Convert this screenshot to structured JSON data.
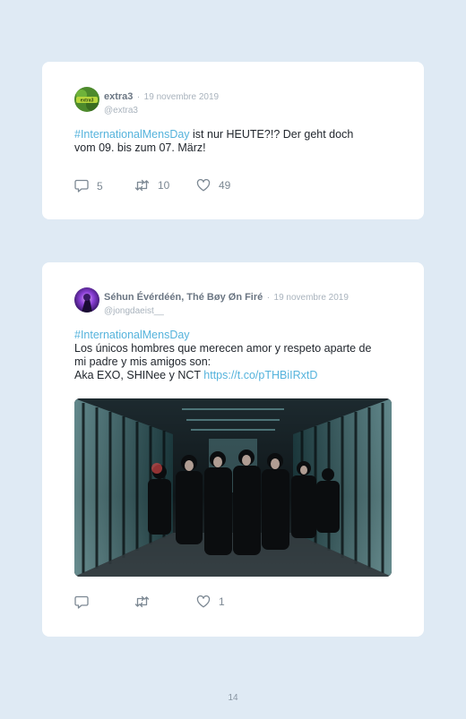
{
  "tweets": [
    {
      "name": "extra3",
      "separator": "·",
      "date": "19 novembre 2019",
      "handle": "@extra3",
      "avatar_text": "extra3",
      "hashtag": "#InternationalMensDay",
      "text_after_tag": " ist nur HEUTE?!? Der geht doch",
      "text_line2": "vom 09. bis zum 07. März!",
      "reply_count": "5",
      "retweet_count": "10",
      "like_count": "49"
    },
    {
      "name": "Séhun Évérdéén, Thé Bøy Øn Firé",
      "separator": "·",
      "date": "19 novembre 2019",
      "handle": "@jongdaeist__",
      "hashtag": "#InternationalMensDay",
      "line2": "Los únicos hombres que merecen amor y respeto aparte de",
      "line3": "mi padre y mis amigos son:",
      "line4_text": "Aka EXO, SHINee y NCT ",
      "line4_link": "https://t.co/pTHBiIRxtD",
      "like_count": "1"
    }
  ],
  "page_number": "14",
  "colors": {
    "background": "#dfeaf4",
    "card": "#ffffff",
    "hashtag": "#55b3dc",
    "meta": "#a9b3bd"
  },
  "icons": [
    "reply-icon",
    "retweet-icon",
    "heart-icon"
  ]
}
